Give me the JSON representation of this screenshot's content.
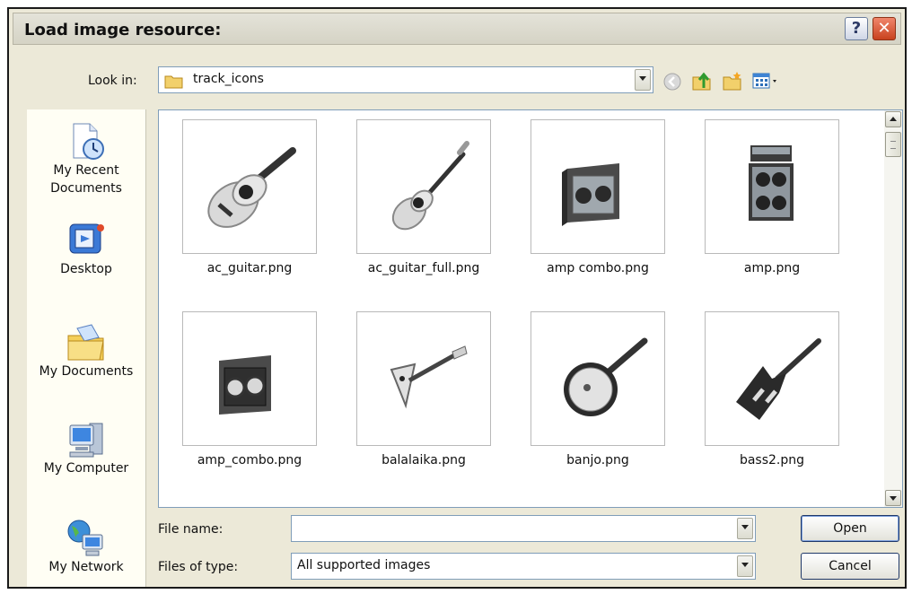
{
  "dialog": {
    "title": "Load image resource:"
  },
  "look_in": {
    "label": "Look in:",
    "value": "track_icons"
  },
  "places": [
    {
      "label": "My Recent\nDocuments",
      "icon": "recent-documents-icon"
    },
    {
      "label": "Desktop",
      "icon": "desktop-icon"
    },
    {
      "label": "My Documents",
      "icon": "my-documents-icon"
    },
    {
      "label": "My Computer",
      "icon": "my-computer-icon"
    },
    {
      "label": "My Network",
      "icon": "my-network-icon"
    }
  ],
  "files": [
    {
      "name": "ac_guitar.png",
      "icon": "acoustic-guitar-icon"
    },
    {
      "name": "ac_guitar_full.png",
      "icon": "acoustic-guitar-full-icon"
    },
    {
      "name": "amp combo.png",
      "icon": "amp-combo-icon"
    },
    {
      "name": "amp.png",
      "icon": "amp-cabinet-icon"
    },
    {
      "name": "amp_combo.png",
      "icon": "amp-combo-icon"
    },
    {
      "name": "balalaika.png",
      "icon": "balalaika-icon"
    },
    {
      "name": "banjo.png",
      "icon": "banjo-icon"
    },
    {
      "name": "bass2.png",
      "icon": "bass-guitar-icon"
    }
  ],
  "file_name": {
    "label": "File name:",
    "value": ""
  },
  "file_type": {
    "label": "Files of type:",
    "value": "All supported images"
  },
  "buttons": {
    "open": "Open",
    "cancel": "Cancel"
  },
  "title_buttons": {
    "help": "?",
    "close": "✕"
  }
}
